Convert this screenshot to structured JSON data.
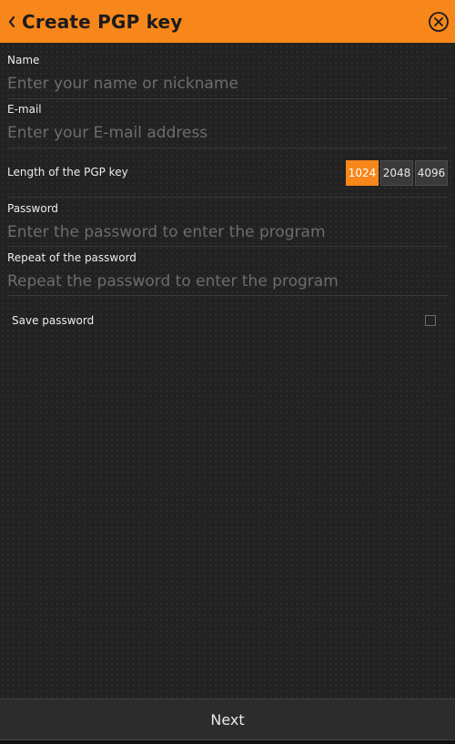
{
  "header": {
    "title": "Create PGP key",
    "accent_color": "#f7861b",
    "back_icon": "chevron-left-icon",
    "close_icon": "close-circle-icon"
  },
  "form": {
    "name": {
      "label": "Name",
      "value": "",
      "placeholder": "Enter your name or nickname"
    },
    "email": {
      "label": "E-mail",
      "value": "",
      "placeholder": "Enter your E-mail address"
    },
    "key_length": {
      "label": "Length of the PGP key",
      "options": [
        "1024",
        "2048",
        "4096"
      ],
      "selected": "1024"
    },
    "password": {
      "label": "Password",
      "value": "",
      "placeholder": "Enter the password to enter the program"
    },
    "repeat_password": {
      "label": "Repeat of the password",
      "value": "",
      "placeholder": "Repeat the password to enter the program"
    },
    "save_password": {
      "label": "Save password",
      "checked": false
    }
  },
  "footer": {
    "next_label": "Next"
  }
}
